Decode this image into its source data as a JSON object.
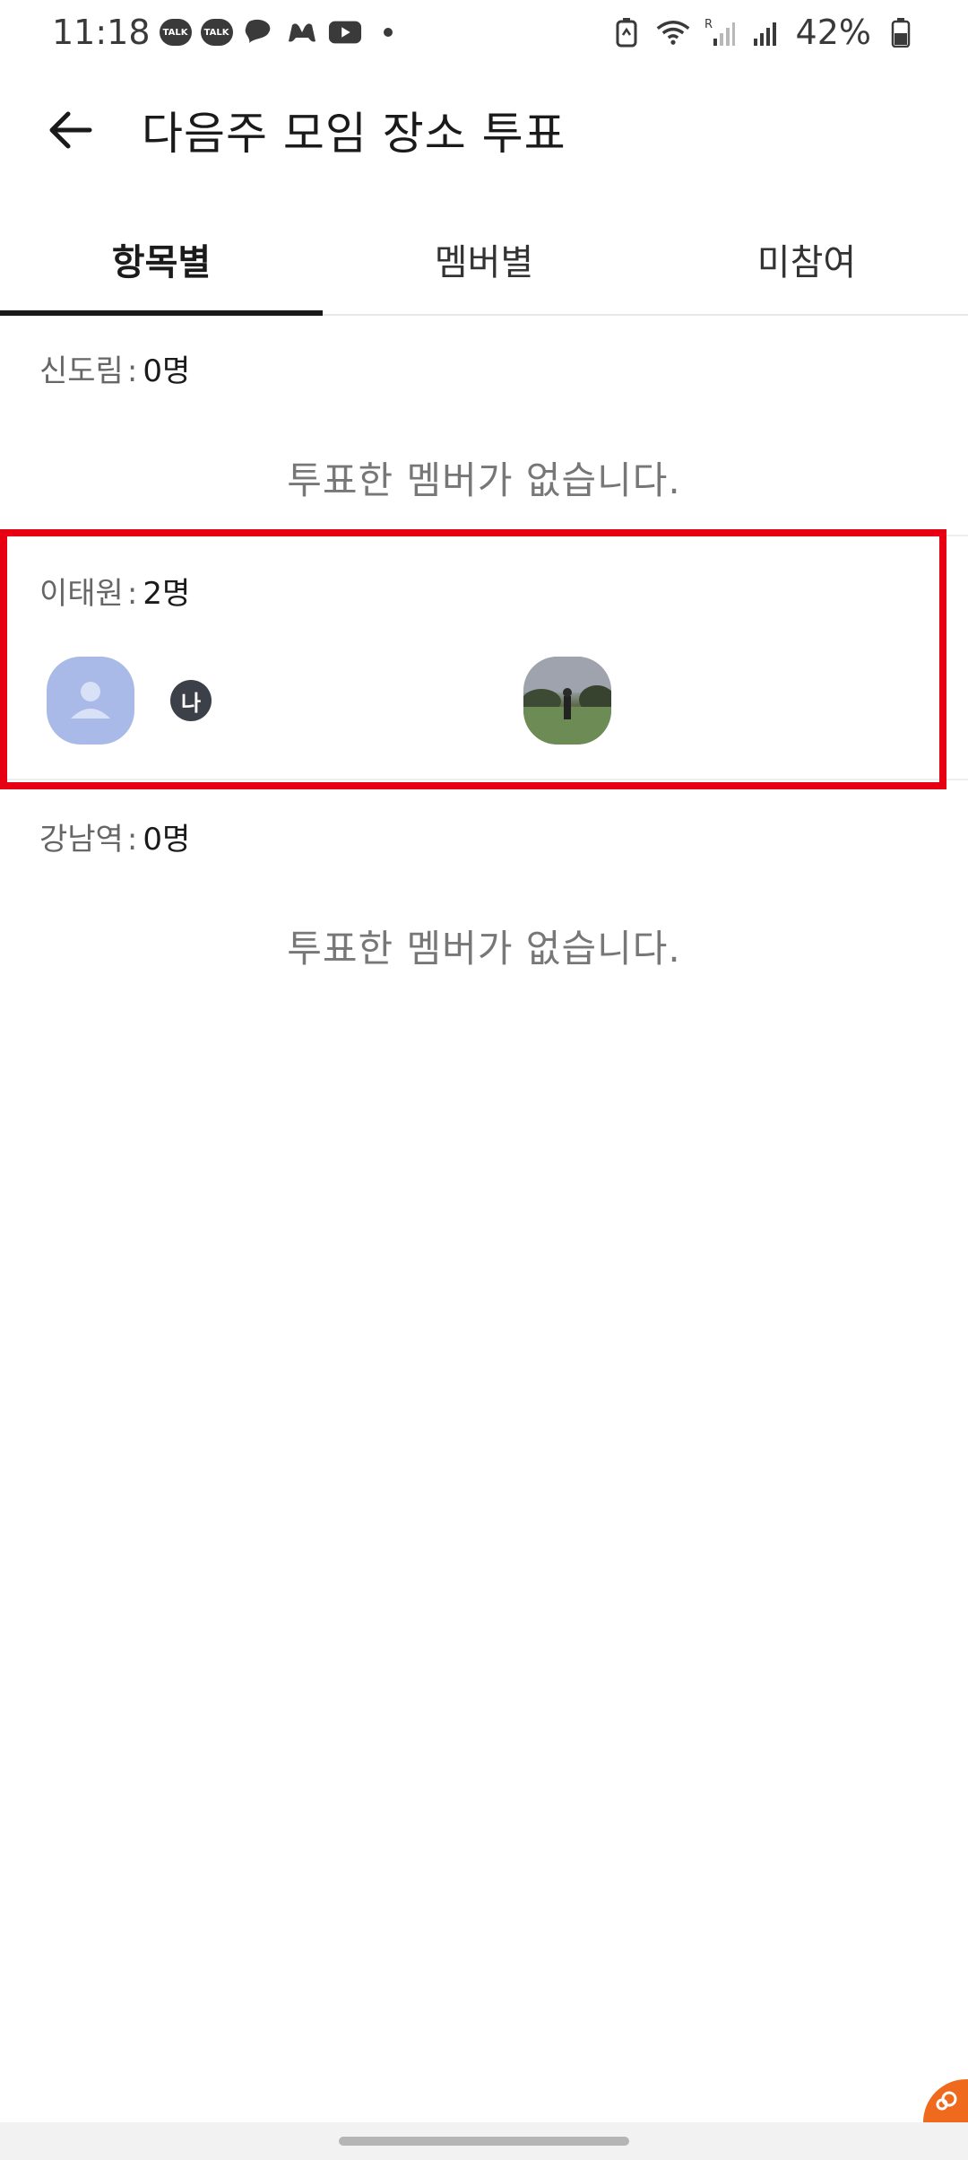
{
  "status_bar": {
    "time": "11:18",
    "battery_percent": "42%",
    "notification_icons": [
      "kakaotalk-icon",
      "kakaotalk-icon",
      "chat-icon",
      "game-icon",
      "youtube-icon",
      "dot-icon"
    ],
    "talk_label": "TALK"
  },
  "header": {
    "title": "다음주 모임 장소 투표"
  },
  "tabs": [
    {
      "label": "항목별",
      "active": true
    },
    {
      "label": "멤버별",
      "active": false
    },
    {
      "label": "미참여",
      "active": false
    }
  ],
  "options": [
    {
      "name": "신도림",
      "separator": ":",
      "count": "0명",
      "empty_message": "투표한 멤버가 없습니다."
    },
    {
      "name": "이태원",
      "separator": ":",
      "count": "2명",
      "me_badge": "나"
    },
    {
      "name": "강남역",
      "separator": ":",
      "count": "0명",
      "empty_message": "투표한 멤버가 없습니다."
    }
  ],
  "colors": {
    "highlight": "#e60012",
    "default_avatar": "#a9b9e8",
    "accent": "#f06a1d"
  }
}
